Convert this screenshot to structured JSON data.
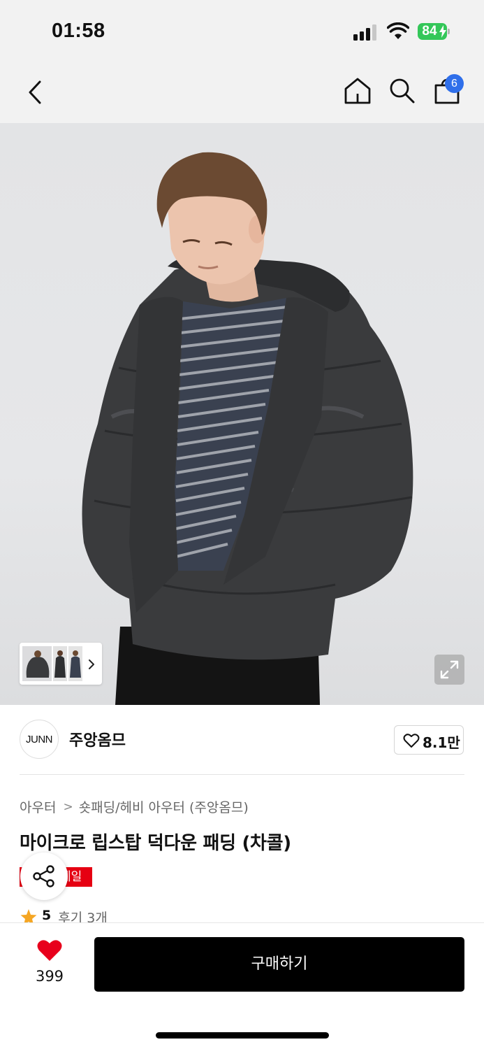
{
  "status_bar": {
    "time": "01:58",
    "battery_level": "84",
    "battery_color": "#34c759",
    "icons": [
      "cellular-signal-icon",
      "wifi-icon",
      "battery-icon"
    ]
  },
  "nav": {
    "icons": [
      "back-chevron-icon",
      "home-icon",
      "search-icon",
      "shopping-bag-icon"
    ],
    "cart_count": "6",
    "badge_color": "#2f6fea"
  },
  "gallery": {
    "thumbnail_count": 3,
    "icons": [
      "chevron-right-icon",
      "expand-icon"
    ]
  },
  "brand": {
    "logo_text": "JUNN",
    "name": "주앙옴므",
    "likes": "8.1만"
  },
  "product": {
    "breadcrumb": [
      "아우터",
      "숏패딩/헤비 아우터 (주앙옴므)"
    ],
    "title": "마이크로 립스탑 덕다운 패딩 (차콜)",
    "sale_label": "세일",
    "sale_color": "#e60012",
    "rating_score": "5",
    "review_text": "후기 3개"
  },
  "actions": {
    "wish_count": "399",
    "wish_color": "#e8001c",
    "buy_label": "구매하기"
  }
}
